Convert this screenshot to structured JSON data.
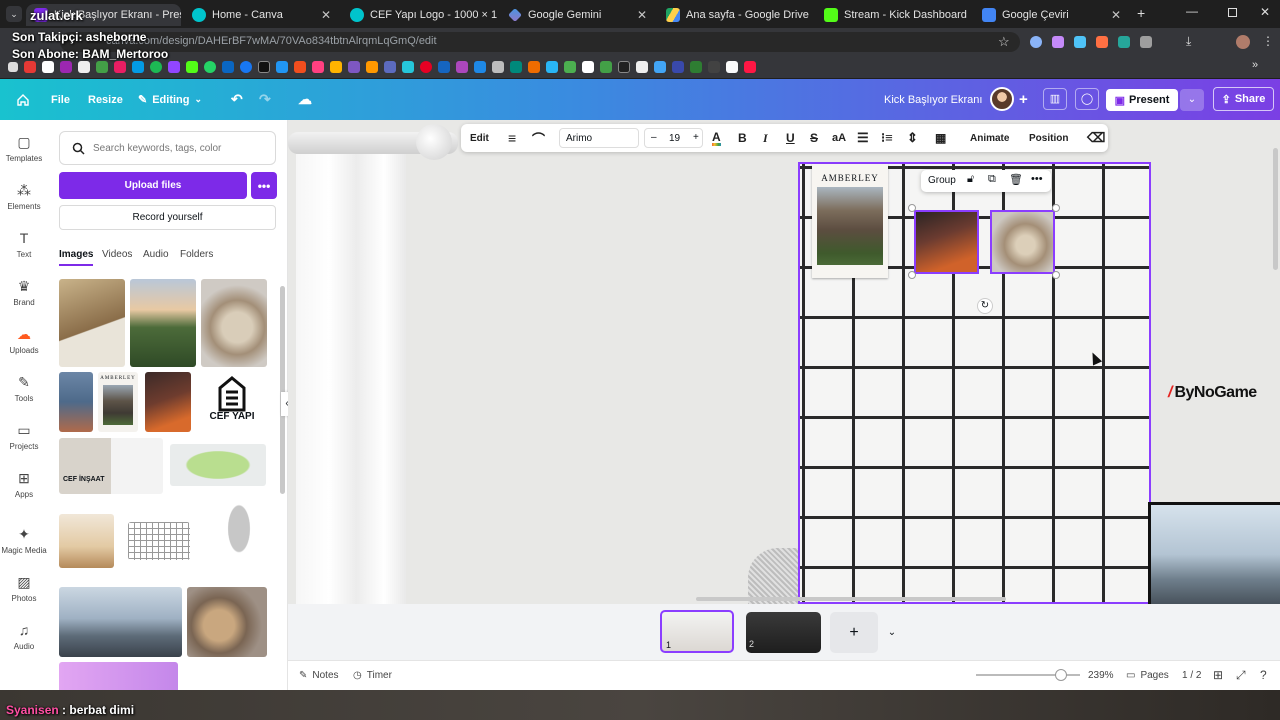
{
  "browser": {
    "tabs": [
      {
        "title": "Kick Başlıyor Ekranı - Presentati",
        "active": true
      },
      {
        "title": "Home - Canva"
      },
      {
        "title": "CEF Yapı Logo - 1000 × 1000px"
      },
      {
        "title": "Google Gemini"
      },
      {
        "title": "Ana sayfa - Google Drive"
      },
      {
        "title": "Stream - Kick Dashboard"
      },
      {
        "title": "Google Çeviri"
      }
    ],
    "url": "canva.com/design/DAHErBF7wMA/70VAo834tbtnAlrqmLqGmQ/edit"
  },
  "overlay": {
    "channel": "zulat.erk",
    "last_follower": "Son Takipçi: asheborne",
    "last_sub": "Son Abone: BAM_Mertoroo",
    "chat_user": "Syanisen",
    "chat_msg": " : berbat dimi",
    "sponsor": "ByNoGame"
  },
  "topbar": {
    "file": "File",
    "resize": "Resize",
    "editing": "Editing",
    "doc_title": "Kick Başlıyor Ekranı",
    "present": "Present",
    "share": "Share"
  },
  "sidebar": {
    "items": [
      {
        "label": "Templates",
        "icon": "templates-icon"
      },
      {
        "label": "Elements",
        "icon": "elements-icon"
      },
      {
        "label": "Text",
        "icon": "text-icon"
      },
      {
        "label": "Brand",
        "icon": "brand-icon"
      },
      {
        "label": "Uploads",
        "icon": "uploads-icon"
      },
      {
        "label": "Tools",
        "icon": "tools-icon"
      },
      {
        "label": "Projects",
        "icon": "projects-icon"
      },
      {
        "label": "Apps",
        "icon": "apps-icon"
      },
      {
        "label": "Magic Media",
        "icon": "magic-media-icon"
      },
      {
        "label": "Photos",
        "icon": "photos-icon"
      },
      {
        "label": "Audio",
        "icon": "audio-icon"
      }
    ]
  },
  "panel": {
    "search_placeholder": "Search keywords, tags, color",
    "upload": "Upload files",
    "record": "Record yourself",
    "tabs": [
      "Images",
      "Videos",
      "Audio",
      "Folders"
    ],
    "amberley_label": "AMBERLEY",
    "cef_label": "CEF YAPI",
    "cef_insaat_label": "CEF İNŞAAT"
  },
  "toolbar": {
    "edit": "Edit",
    "font": "Arimo",
    "font_size": "19",
    "animate": "Animate",
    "position": "Position"
  },
  "selection": {
    "group": "Group"
  },
  "canvas": {
    "amberley_title": "AMBERLEY"
  },
  "pages": {
    "page1": "1",
    "page2": "2"
  },
  "footer": {
    "notes": "Notes",
    "timer": "Timer",
    "zoom": "239%",
    "zoom_level": 0.82,
    "pages": "Pages",
    "page_count": "1 / 2"
  }
}
